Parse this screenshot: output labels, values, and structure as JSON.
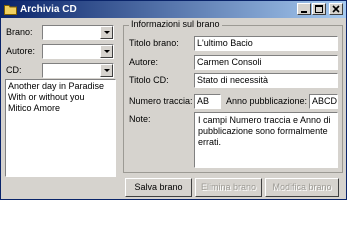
{
  "window": {
    "title": "Archivia CD"
  },
  "filters": {
    "brano_label": "Brano:",
    "autore_label": "Autore:",
    "cd_label": "CD:"
  },
  "songs": [
    "Another day in Paradise",
    "With or without you",
    "Mitico Amore"
  ],
  "details": {
    "group_title": "Informazioni sul brano",
    "titolo_label": "Titolo brano:",
    "titolo_value": "L'ultimo Bacio",
    "autore_label": "Autore:",
    "autore_value": "Carmen Consoli",
    "titolo_cd_label": "Titolo CD:",
    "titolo_cd_value": "Stato di necessità",
    "numero_label": "Numero traccia:",
    "numero_value": "AB",
    "anno_label": "Anno pubblicazione:",
    "anno_value": "ABCD",
    "note_label": "Note:",
    "note_value": "I campi Numero traccia e Anno di pubblicazione sono formalmente errati."
  },
  "buttons": {
    "salva": "Salva brano",
    "elimina": "Elimina brano",
    "modifica": "Modifica brano"
  },
  "colors": {
    "titlebar_start": "#0a246a",
    "titlebar_end": "#a6caf0",
    "face": "#d6d3ce"
  }
}
